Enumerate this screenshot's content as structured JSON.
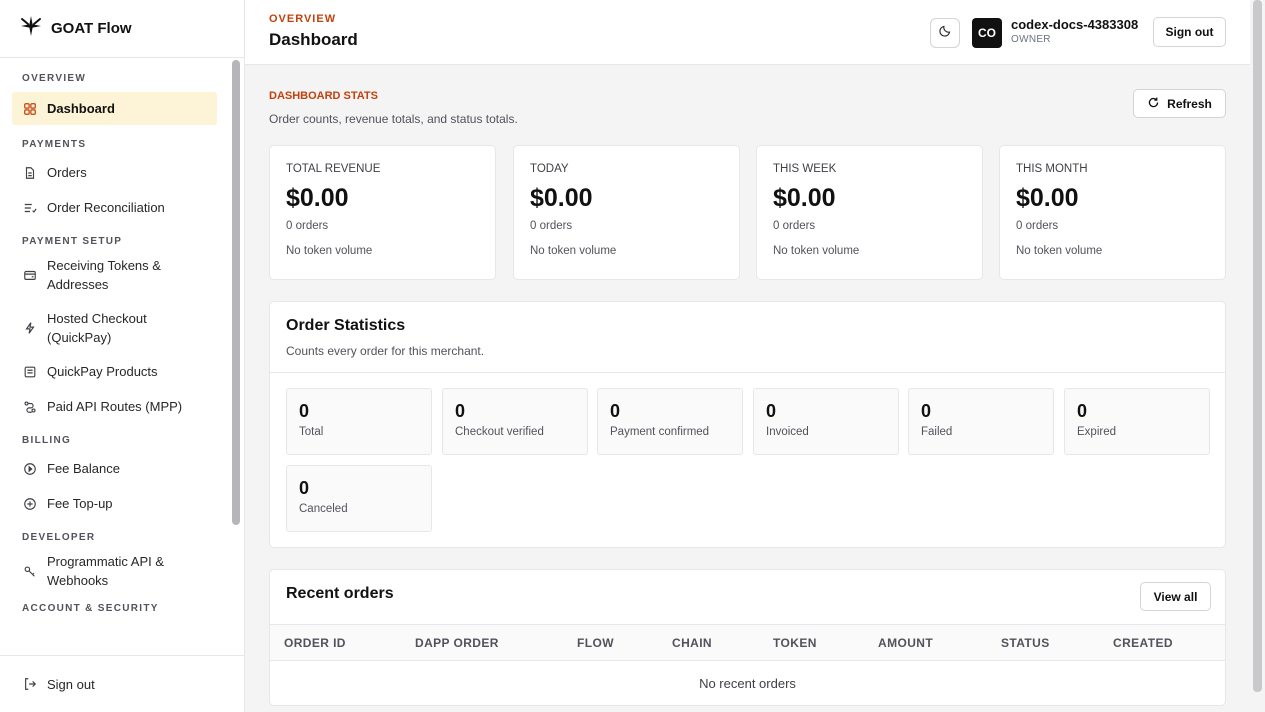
{
  "app": {
    "name": "GOAT Flow"
  },
  "sidebar": {
    "sections": [
      {
        "title": "OVERVIEW",
        "items": [
          {
            "label": "Dashboard",
            "icon": "grid-icon",
            "active": true
          }
        ]
      },
      {
        "title": "PAYMENTS",
        "items": [
          {
            "label": "Orders",
            "icon": "document-icon"
          },
          {
            "label": "Order Reconciliation",
            "icon": "list-check-icon"
          }
        ]
      },
      {
        "title": "PAYMENT SETUP",
        "items": [
          {
            "label": "Receiving Tokens & Addresses",
            "icon": "wallet-icon"
          },
          {
            "label": "Hosted Checkout (QuickPay)",
            "icon": "lightning-icon"
          },
          {
            "label": "QuickPay Products",
            "icon": "receipt-icon"
          },
          {
            "label": "Paid API Routes (MPP)",
            "icon": "route-icon"
          }
        ]
      },
      {
        "title": "BILLING",
        "items": [
          {
            "label": "Fee Balance",
            "icon": "play-circle-icon"
          },
          {
            "label": "Fee Top-up",
            "icon": "plus-circle-icon"
          }
        ]
      },
      {
        "title": "DEVELOPER",
        "items": [
          {
            "label": "Programmatic API & Webhooks",
            "icon": "key-icon"
          }
        ]
      },
      {
        "title": "ACCOUNT & SECURITY",
        "items": []
      }
    ],
    "sign_out": "Sign out"
  },
  "header": {
    "eyebrow": "OVERVIEW",
    "title": "Dashboard",
    "avatar_initials": "CO",
    "user_name": "codex-docs-4383308",
    "user_role": "OWNER",
    "sign_out": "Sign out"
  },
  "stats": {
    "eyebrow": "DASHBOARD STATS",
    "description": "Order counts, revenue totals, and status totals.",
    "refresh": "Refresh",
    "cards": [
      {
        "label": "TOTAL REVENUE",
        "value": "$0.00",
        "orders": "0 orders",
        "token": "No token volume"
      },
      {
        "label": "TODAY",
        "value": "$0.00",
        "orders": "0 orders",
        "token": "No token volume"
      },
      {
        "label": "THIS WEEK",
        "value": "$0.00",
        "orders": "0 orders",
        "token": "No token volume"
      },
      {
        "label": "THIS MONTH",
        "value": "$0.00",
        "orders": "0 orders",
        "token": "No token volume"
      }
    ]
  },
  "order_stats": {
    "title": "Order Statistics",
    "description": "Counts every order for this merchant.",
    "tiles": [
      {
        "value": "0",
        "label": "Total"
      },
      {
        "value": "0",
        "label": "Checkout verified"
      },
      {
        "value": "0",
        "label": "Payment confirmed"
      },
      {
        "value": "0",
        "label": "Invoiced"
      },
      {
        "value": "0",
        "label": "Failed"
      },
      {
        "value": "0",
        "label": "Expired"
      },
      {
        "value": "0",
        "label": "Canceled"
      }
    ]
  },
  "recent_orders": {
    "title": "Recent orders",
    "view_all": "View all",
    "columns": [
      "ORDER ID",
      "DAPP ORDER",
      "FLOW",
      "CHAIN",
      "TOKEN",
      "AMOUNT",
      "STATUS",
      "CREATED"
    ],
    "empty": "No recent orders"
  },
  "colors": {
    "accent": "#c2410c",
    "active_bg": "#fdf3d6",
    "page_bg": "#f4f4f5"
  }
}
